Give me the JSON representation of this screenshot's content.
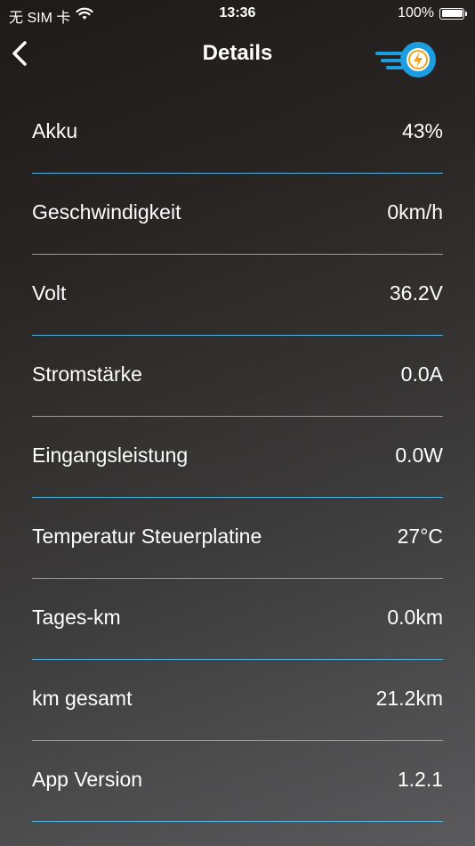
{
  "status_bar": {
    "carrier": "无 SIM 卡",
    "time": "13:36",
    "battery_percent": "100%",
    "battery_level": 1.0
  },
  "nav": {
    "title": "Details",
    "back_icon": "chevron-left-icon",
    "logo_icon": "bolt-logo-icon",
    "accent_color": "#1a9ee0",
    "logo_bolt_color": "#f5a21b"
  },
  "divider_color": "#4fb3e0",
  "details": [
    {
      "label": "Akku",
      "value": "43%"
    },
    {
      "label": "Geschwindigkeit",
      "value": "0km/h"
    },
    {
      "label": "Volt",
      "value": "36.2V"
    },
    {
      "label": "Stromstärke",
      "value": "0.0A"
    },
    {
      "label": "Eingangsleistung",
      "value": "0.0W"
    },
    {
      "label": "Temperatur Steuerplatine",
      "value": "27°C"
    },
    {
      "label": "Tages-km",
      "value": "0.0km"
    },
    {
      "label": "km gesamt",
      "value": "21.2km"
    },
    {
      "label": "App Version",
      "value": "1.2.1"
    }
  ]
}
